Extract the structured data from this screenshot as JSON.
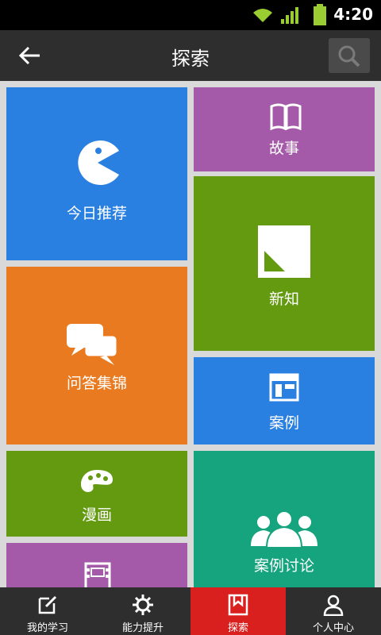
{
  "status_bar": {
    "time": "4:20",
    "icons": [
      "wifi-icon",
      "signal-icon",
      "battery-icon"
    ]
  },
  "app_bar": {
    "title": "探索",
    "back_icon": "arrow-left-icon",
    "search_icon": "search-icon"
  },
  "tiles": [
    {
      "label": "今日推荐",
      "icon": "pacman-icon",
      "color": "#2a80e0"
    },
    {
      "label": "故事",
      "icon": "book-icon",
      "color": "#a45aa8"
    },
    {
      "label": "新知",
      "icon": "new-knowledge-icon",
      "color": "#639a10"
    },
    {
      "label": "问答集锦",
      "icon": "chat-bubbles-icon",
      "color": "#ea7a1f"
    },
    {
      "label": "案例",
      "icon": "layout-icon",
      "color": "#2a80e0"
    },
    {
      "label": "漫画",
      "icon": "palette-icon",
      "color": "#639a10"
    },
    {
      "label": "案例讨论",
      "icon": "people-group-icon",
      "color": "#16a47e"
    },
    {
      "label": "",
      "icon": "film-icon",
      "color": "#a45aa8"
    }
  ],
  "tab_bar": {
    "tabs": [
      {
        "label": "我的学习",
        "icon": "edit-icon",
        "active": false
      },
      {
        "label": "能力提升",
        "icon": "gear-icon",
        "active": false
      },
      {
        "label": "探索",
        "icon": "bookmark-icon",
        "active": true
      },
      {
        "label": "个人中心",
        "icon": "user-icon",
        "active": false
      }
    ],
    "active_color": "#d9201f"
  }
}
